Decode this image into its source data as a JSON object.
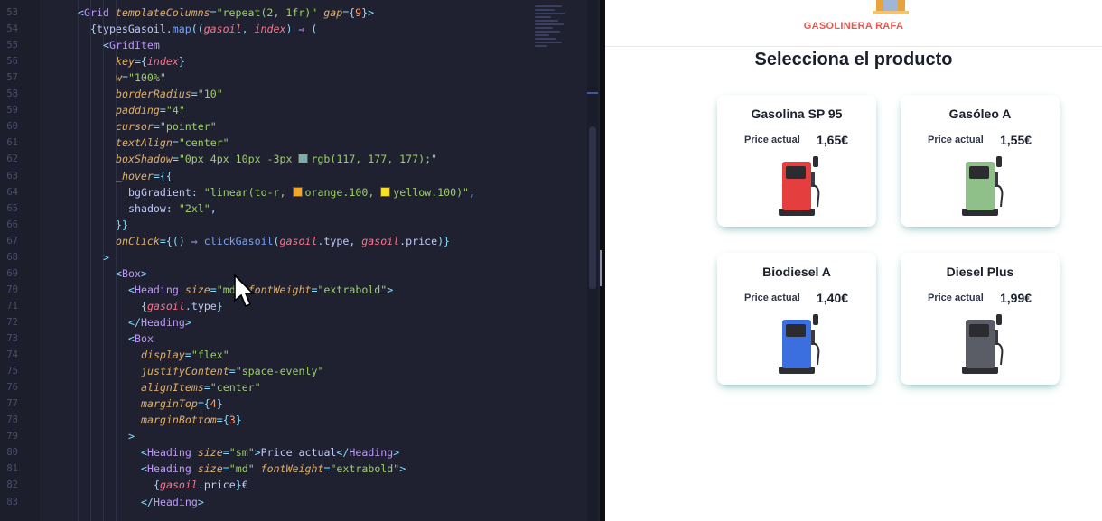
{
  "editor": {
    "lines": [
      {
        "n": "53",
        "indent": 0,
        "html": "<span class=\"br\">&lt;</span><span class=\"tag\">Grid</span> <span class=\"attr\">templateColumns</span><span class=\"br\">=</span><span class=\"str\">\"repeat(2, 1fr)\"</span> <span class=\"attr\">gap</span><span class=\"br\">={</span><span class=\"num\">9</span><span class=\"br\">}&gt;</span>"
      },
      {
        "n": "54",
        "indent": 1,
        "html": "<span class=\"br\">{</span><span class=\"txt\">typesGasoil</span><span class=\"br\">.</span><span class=\"fn\">map</span><span class=\"br\">((</span><span class=\"var\">gasoil</span><span class=\"br\">,</span> <span class=\"var\">index</span><span class=\"br\">)</span> <span class=\"kw\">⇒</span> <span class=\"br\">(</span>"
      },
      {
        "n": "55",
        "indent": 2,
        "html": "<span class=\"br\">&lt;</span><span class=\"tag\">GridItem</span>"
      },
      {
        "n": "56",
        "indent": 3,
        "html": "<span class=\"attr\">key</span><span class=\"br\">={</span><span class=\"var\">index</span><span class=\"br\">}</span>"
      },
      {
        "n": "57",
        "indent": 3,
        "html": "<span class=\"attr\">w</span><span class=\"br\">=</span><span class=\"str\">\"100%\"</span>"
      },
      {
        "n": "58",
        "indent": 3,
        "html": "<span class=\"attr\">borderRadius</span><span class=\"br\">=</span><span class=\"str\">\"10\"</span>"
      },
      {
        "n": "59",
        "indent": 3,
        "html": "<span class=\"attr\">padding</span><span class=\"br\">=</span><span class=\"str\">\"4\"</span>"
      },
      {
        "n": "60",
        "indent": 3,
        "html": "<span class=\"attr\">cursor</span><span class=\"br\">=</span><span class=\"str\">\"pointer\"</span>"
      },
      {
        "n": "61",
        "indent": 3,
        "html": "<span class=\"attr\">textAlign</span><span class=\"br\">=</span><span class=\"str\">\"center\"</span>"
      },
      {
        "n": "62",
        "indent": 3,
        "html": "<span class=\"attr\">boxShadow</span><span class=\"br\">=</span><span class=\"str\">\"0px 4px 10px -3px <span class=\"sw\" style=\"background:#75b1b1\"></span>rgb(117, 177, 177);\"</span>"
      },
      {
        "n": "63",
        "indent": 3,
        "html": "<span class=\"attr\">_hover</span><span class=\"br\">={{</span>"
      },
      {
        "n": "64",
        "indent": 4,
        "html": "<span class=\"txt\">bgGradient</span><span class=\"br\">:</span> <span class=\"str\">\"linear(to-r, <span class=\"sw\" style=\"background:#f6a623\"></span>orange.100, <span class=\"sw\" style=\"background:#f7e027\"></span>yellow.100)\"</span><span class=\"br\">,</span>"
      },
      {
        "n": "65",
        "indent": 4,
        "html": "<span class=\"txt\">shadow</span><span class=\"br\">:</span> <span class=\"str\">\"2xl\"</span><span class=\"br\">,</span>"
      },
      {
        "n": "66",
        "indent": 3,
        "html": "<span class=\"br\">}}</span>"
      },
      {
        "n": "67",
        "indent": 3,
        "html": "<span class=\"attr\">onClick</span><span class=\"br\">={()</span> <span class=\"kw\">⇒</span> <span class=\"fn\">clickGasoil</span><span class=\"br\">(</span><span class=\"var\">gasoil</span><span class=\"br\">.</span><span class=\"txt\">type</span><span class=\"br\">,</span> <span class=\"var\">gasoil</span><span class=\"br\">.</span><span class=\"txt\">price</span><span class=\"br\">)}</span>"
      },
      {
        "n": "68",
        "indent": 2,
        "html": "<span class=\"br\">&gt;</span>"
      },
      {
        "n": "69",
        "indent": 3,
        "html": "<span class=\"br\">&lt;</span><span class=\"tag\">Box</span><span class=\"br\">&gt;</span>"
      },
      {
        "n": "70",
        "indent": 4,
        "html": "<span class=\"br\">&lt;</span><span class=\"tag\">Heading</span> <span class=\"attr\">size</span><span class=\"br\">=</span><span class=\"str\">\"md\"</span> <span class=\"attr\">fontWeight</span><span class=\"br\">=</span><span class=\"str\">\"extrabold\"</span><span class=\"br\">&gt;</span>"
      },
      {
        "n": "71",
        "indent": 5,
        "html": "<span class=\"br\">{</span><span class=\"var\">gasoil</span><span class=\"br\">.</span><span class=\"txt\">type</span><span class=\"br\">}</span>"
      },
      {
        "n": "72",
        "indent": 4,
        "html": "<span class=\"br\">&lt;/</span><span class=\"tag\">Heading</span><span class=\"br\">&gt;</span>"
      },
      {
        "n": "73",
        "indent": 4,
        "html": "<span class=\"br\">&lt;</span><span class=\"tag\">Box</span>"
      },
      {
        "n": "74",
        "indent": 5,
        "html": "<span class=\"attr\">display</span><span class=\"br\">=</span><span class=\"str\">\"flex\"</span>"
      },
      {
        "n": "75",
        "indent": 5,
        "html": "<span class=\"attr\">justifyContent</span><span class=\"br\">=</span><span class=\"str\">\"space-evenly\"</span>"
      },
      {
        "n": "76",
        "indent": 5,
        "html": "<span class=\"attr\">alignItems</span><span class=\"br\">=</span><span class=\"str\">\"center\"</span>"
      },
      {
        "n": "77",
        "indent": 5,
        "html": "<span class=\"attr\">marginTop</span><span class=\"br\">={</span><span class=\"num\">4</span><span class=\"br\">}</span>"
      },
      {
        "n": "78",
        "indent": 5,
        "html": "<span class=\"attr\">marginBottom</span><span class=\"br\">={</span><span class=\"num\">3</span><span class=\"br\">}</span>"
      },
      {
        "n": "79",
        "indent": 4,
        "html": "<span class=\"br\">&gt;</span>"
      },
      {
        "n": "80",
        "indent": 5,
        "html": "<span class=\"br\">&lt;</span><span class=\"tag\">Heading</span> <span class=\"attr\">size</span><span class=\"br\">=</span><span class=\"str\">\"sm\"</span><span class=\"br\">&gt;</span><span class=\"txt\">Price actual</span><span class=\"br\">&lt;/</span><span class=\"tag\">Heading</span><span class=\"br\">&gt;</span>"
      },
      {
        "n": "81",
        "indent": 5,
        "html": "<span class=\"br\">&lt;</span><span class=\"tag\">Heading</span> <span class=\"attr\">size</span><span class=\"br\">=</span><span class=\"str\">\"md\"</span> <span class=\"attr\">fontWeight</span><span class=\"br\">=</span><span class=\"str\">\"extrabold\"</span><span class=\"br\">&gt;</span>"
      },
      {
        "n": "82",
        "indent": 6,
        "html": "<span class=\"br\">{</span><span class=\"var\">gasoil</span><span class=\"br\">.</span><span class=\"txt\">price</span><span class=\"br\">}</span><span class=\"txt\">€</span>"
      },
      {
        "n": "83",
        "indent": 5,
        "html": "<span class=\"br\">&lt;/</span><span class=\"tag\">Heading</span><span class=\"br\">&gt;</span>"
      }
    ]
  },
  "app": {
    "brand": "GASOLINERA RAFA",
    "title": "Selecciona el producto",
    "price_label": "Price actual",
    "products": [
      {
        "type": "Gasolina SP 95",
        "price": "1,65€",
        "color": "#e53e3e"
      },
      {
        "type": "Gasóleo A",
        "price": "1,55€",
        "color": "#8fc08a"
      },
      {
        "type": "Biodiesel A",
        "price": "1,40€",
        "color": "#3b6fe0"
      },
      {
        "type": "Diesel Plus",
        "price": "1,99€",
        "color": "#5a5d66"
      }
    ]
  }
}
